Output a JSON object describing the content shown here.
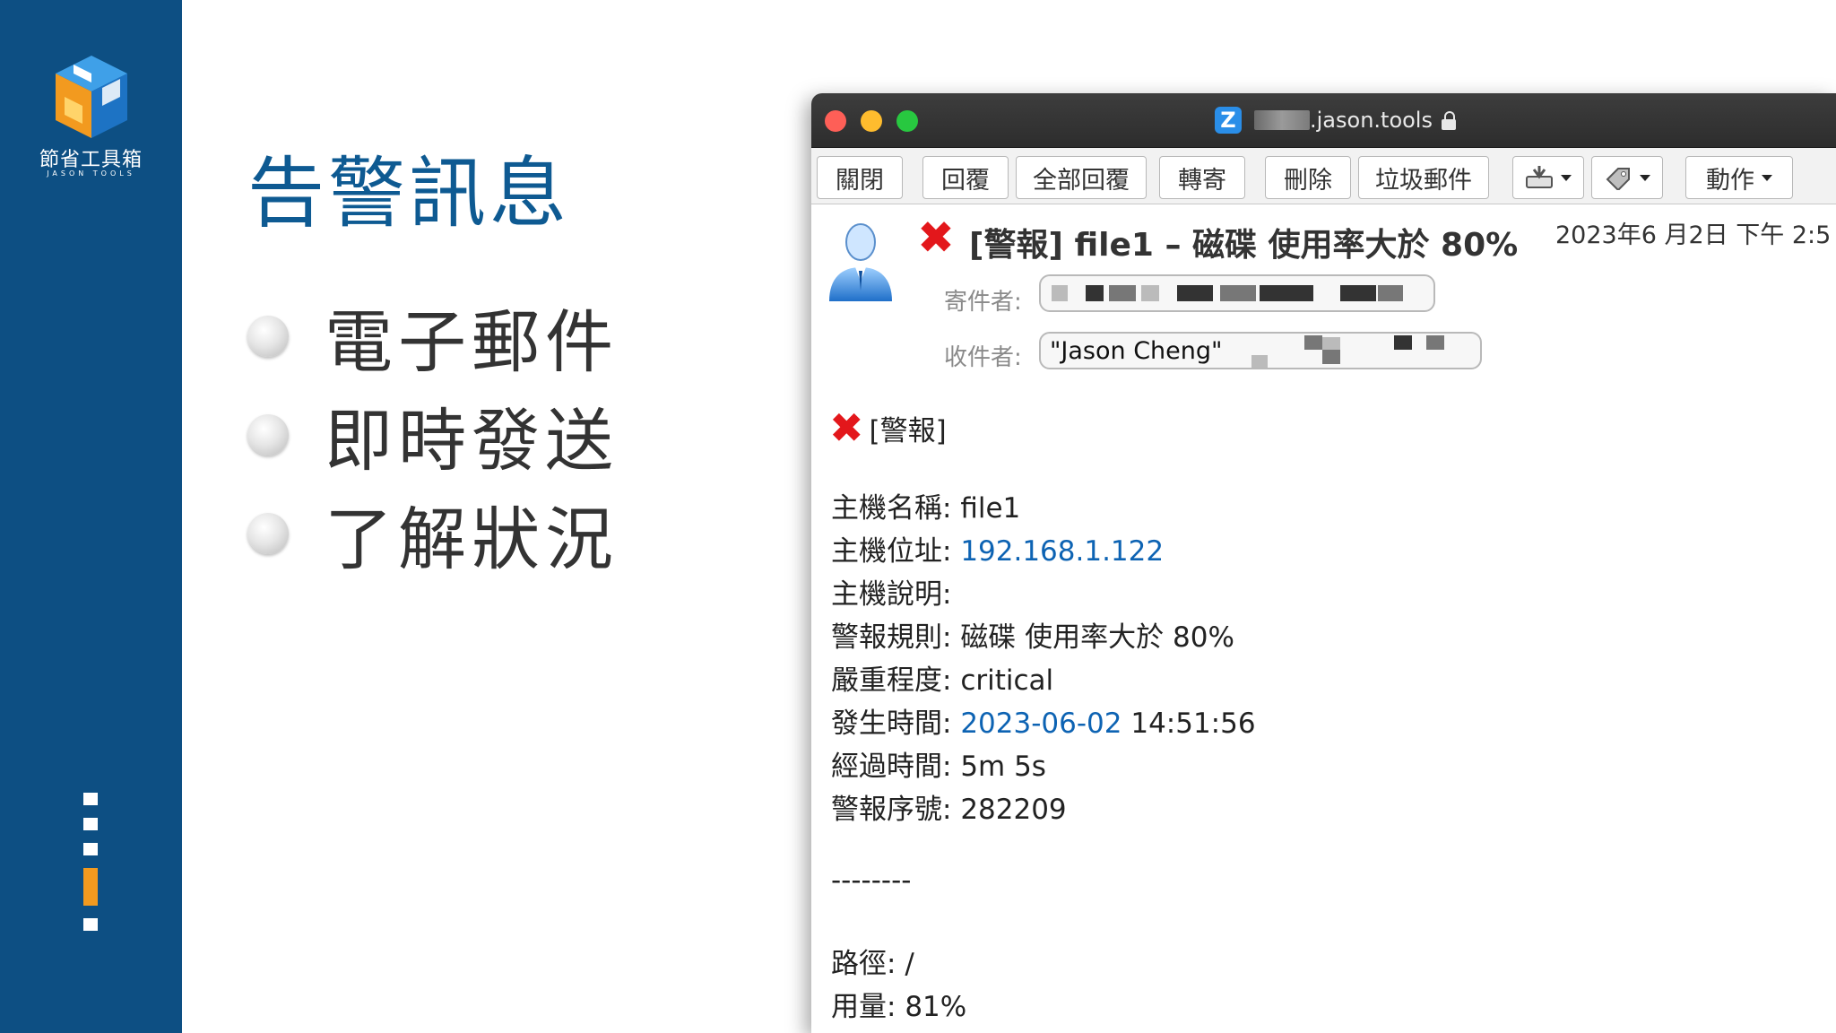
{
  "brand": {
    "name_cn": "節省工具箱",
    "name_en": "JASON TOOLS"
  },
  "slide": {
    "title": "告警訊息",
    "bullets": [
      "電子郵件",
      "即時發送",
      "了解狀況"
    ],
    "progress": {
      "total": 6,
      "active_index": 4
    }
  },
  "window": {
    "title_suffix": ".jason.tools",
    "app_icon_letter": "Z"
  },
  "toolbar": {
    "close": "關閉",
    "reply": "回覆",
    "reply_all": "全部回覆",
    "forward": "轉寄",
    "delete": "刪除",
    "spam": "垃圾郵件",
    "actions": "動作"
  },
  "message": {
    "subject": "[警報] file1 – 磁碟 使用率大於 80%",
    "date": "2023年6 月2日 下午 2:5",
    "from_label": "寄件者:",
    "to_label": "收件者:",
    "to_value": "\"Jason Cheng\""
  },
  "body": {
    "alert_heading": "[警報]",
    "lines": [
      {
        "label": "主機名稱",
        "value": "file1",
        "link": ""
      },
      {
        "label": "主機位址",
        "value": "",
        "link": "192.168.1.122"
      },
      {
        "label": "主機說明",
        "value": "",
        "link": ""
      },
      {
        "label": "警報規則",
        "value": "磁碟 使用率大於 80%",
        "link": ""
      },
      {
        "label": "嚴重程度",
        "value": "critical",
        "link": ""
      },
      {
        "label": "發生時間",
        "value": "14:51:56",
        "link": "2023-06-02"
      },
      {
        "label": "經過時間",
        "value": "5m 5s",
        "link": ""
      },
      {
        "label": "警報序號",
        "value": "282209",
        "link": ""
      }
    ],
    "separator": "--------",
    "lines2": [
      {
        "label": "路徑",
        "value": "/"
      },
      {
        "label": "用量",
        "value": "81%"
      }
    ]
  },
  "colors": {
    "sidebar": "#0d4f83",
    "title": "#0e5a92",
    "progress_active": "#f29a1f",
    "alert_red": "#e3171b",
    "link_blue": "#0d63b3"
  }
}
